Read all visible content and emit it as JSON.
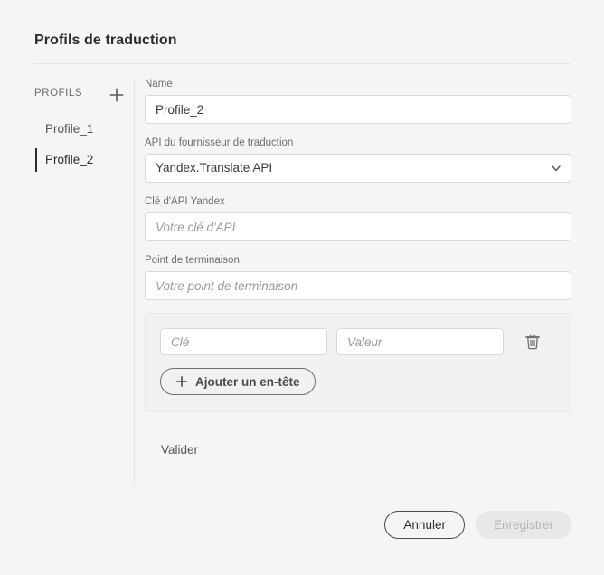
{
  "dialog": {
    "title": "Profils de traduction"
  },
  "sidebar": {
    "header_label": "PROFILS",
    "add_label": "+",
    "items": [
      {
        "label": "Profile_1",
        "selected": false
      },
      {
        "label": "Profile_2",
        "selected": true
      }
    ]
  },
  "form": {
    "name": {
      "label": "Name",
      "value": "Profile_2",
      "placeholder": ""
    },
    "provider": {
      "label": "API du fournisseur de traduction",
      "value": "Yandex.Translate API"
    },
    "api_key": {
      "label": "Clé d'API Yandex",
      "value": "",
      "placeholder": "Votre clé d'API"
    },
    "endpoint": {
      "label": "Point de terminaison",
      "value": "",
      "placeholder": "Votre point de terminaison"
    },
    "headers": {
      "key_placeholder": "Clé",
      "key_value": "",
      "value_placeholder": "Valeur",
      "value_value": "",
      "add_label": "Ajouter un en-tête"
    },
    "validate_label": "Valider"
  },
  "footer": {
    "cancel_label": "Annuler",
    "save_label": "Enregistrer"
  },
  "colors": {
    "page_background": "#f5f5f5",
    "input_background": "#ffffff",
    "input_border": "#d8d8d8",
    "panel_background": "#f1f1f1",
    "text_primary": "#2c2c2c",
    "text_secondary": "#6e6e6e",
    "selected_indicator": "#2c2c2c",
    "disabled_button_background": "#e8e8e8",
    "disabled_button_text": "#b4b4b4"
  }
}
